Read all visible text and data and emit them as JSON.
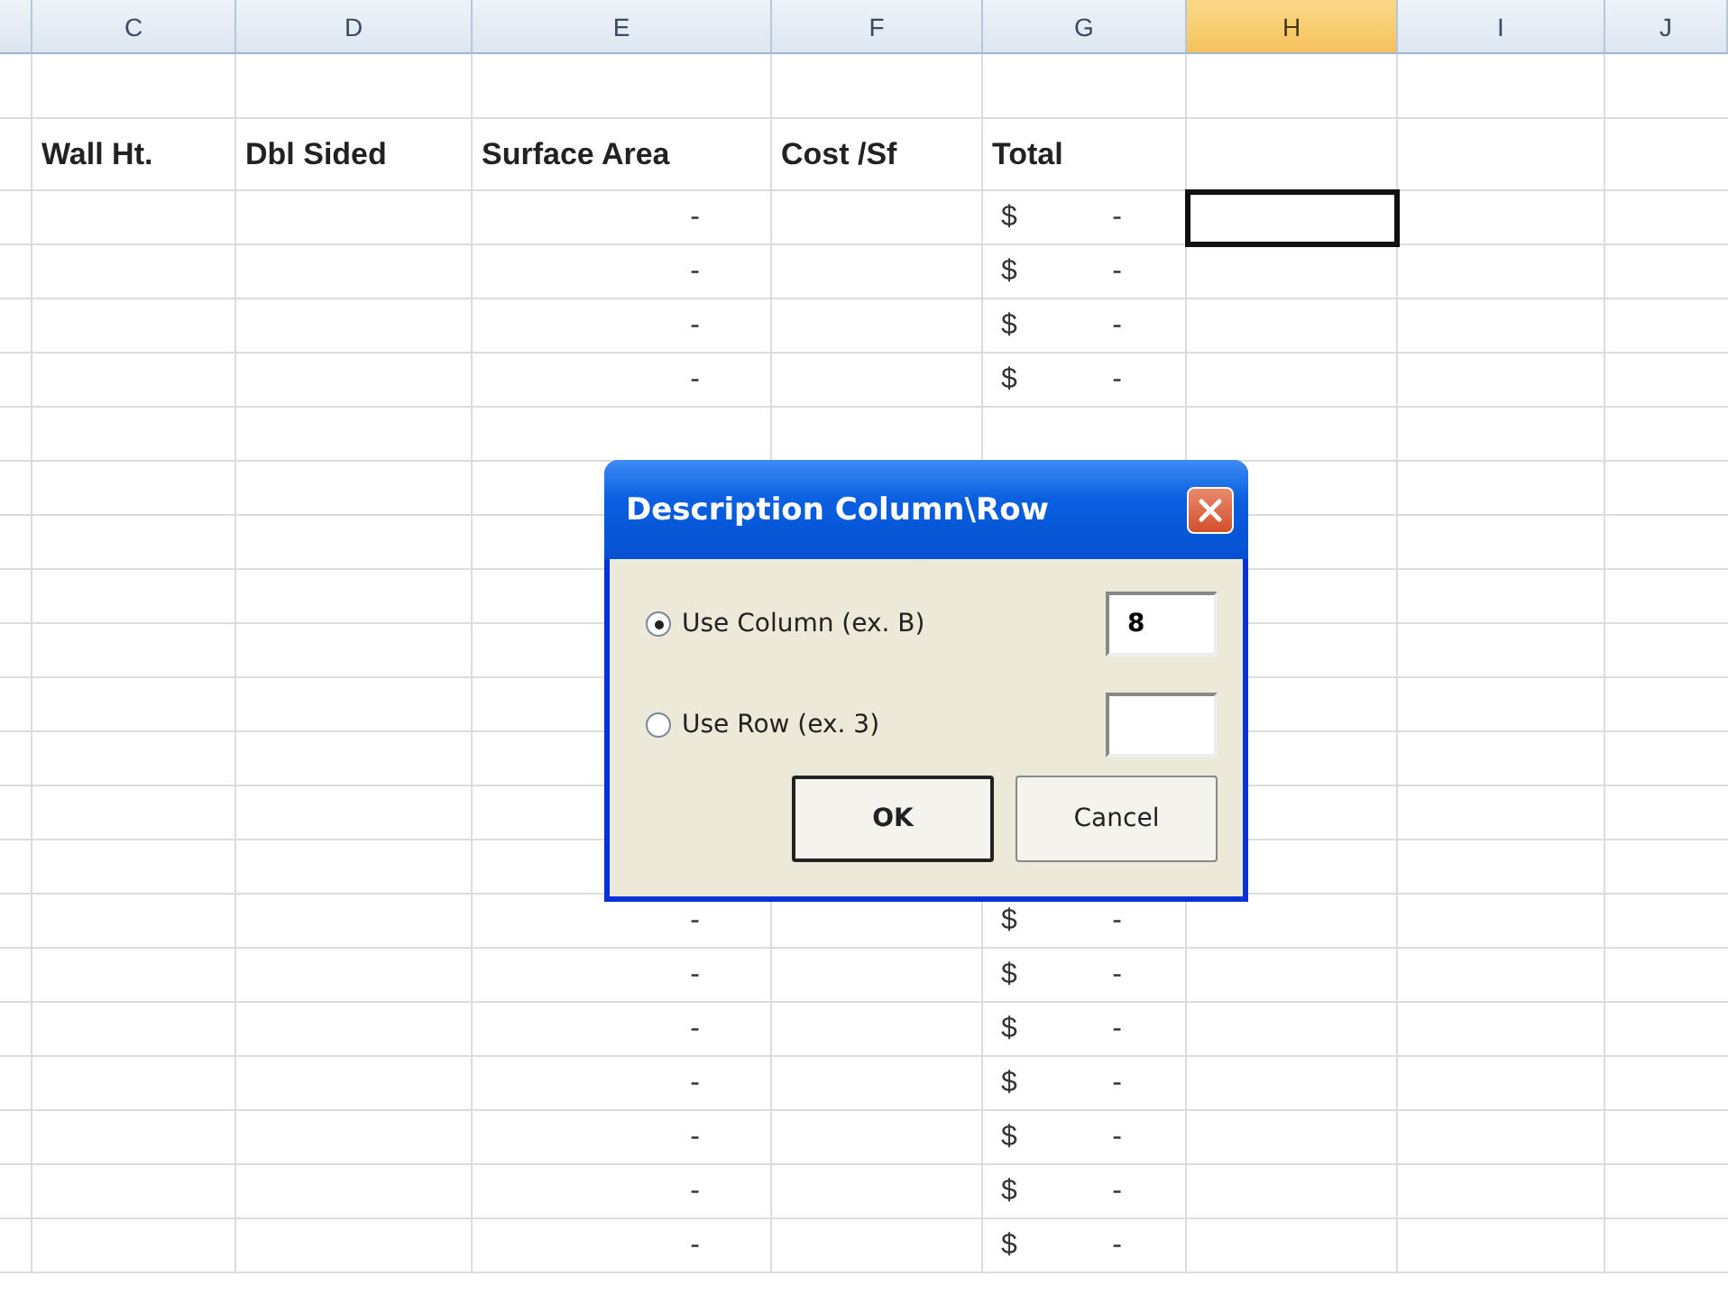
{
  "column_headers": [
    {
      "label": "C",
      "selected": false
    },
    {
      "label": "D",
      "selected": false
    },
    {
      "label": "E",
      "selected": false
    },
    {
      "label": "F",
      "selected": false
    },
    {
      "label": "G",
      "selected": false
    },
    {
      "label": "H",
      "selected": true
    },
    {
      "label": "I",
      "selected": false
    },
    {
      "label": "J",
      "selected": false
    }
  ],
  "table": {
    "columns": [
      "Wall Ht.",
      "Dbl Sided",
      "Surface Area",
      "Cost /Sf",
      "Total"
    ],
    "rows": [
      {
        "surface_area": "-",
        "currency": "$",
        "total": "-",
        "selected": true
      },
      {
        "surface_area": "-",
        "currency": "$",
        "total": "-",
        "selected": false
      },
      {
        "surface_area": "-",
        "currency": "$",
        "total": "-",
        "selected": false
      },
      {
        "surface_area": "-",
        "currency": "$",
        "total": "-",
        "selected": false
      },
      {
        "selected": false
      },
      {
        "selected": false
      },
      {
        "selected": false
      },
      {
        "selected": false
      },
      {
        "selected": false
      },
      {
        "selected": false
      },
      {
        "selected": false
      },
      {
        "selected": false
      },
      {
        "selected": false
      },
      {
        "surface_area": "-",
        "currency": "$",
        "total": "-",
        "selected": false
      },
      {
        "surface_area": "-",
        "currency": "$",
        "total": "-",
        "selected": false
      },
      {
        "surface_area": "-",
        "currency": "$",
        "total": "-",
        "selected": false
      },
      {
        "surface_area": "-",
        "currency": "$",
        "total": "-",
        "selected": false
      },
      {
        "surface_area": "-",
        "currency": "$",
        "total": "-",
        "selected": false
      },
      {
        "surface_area": "-",
        "currency": "$",
        "total": "-",
        "selected": false
      },
      {
        "surface_area": "-",
        "currency": "$",
        "total": "-",
        "selected": false
      }
    ]
  },
  "dialog": {
    "title": "Description Column\\Row",
    "options": [
      {
        "label": "Use Column (ex. B)",
        "selected": true,
        "value": "8"
      },
      {
        "label": "Use Row (ex. 3)",
        "selected": false
      }
    ],
    "buttons": [
      {
        "label": "OK",
        "default": true
      },
      {
        "label": "Cancel",
        "default": false
      }
    ]
  }
}
